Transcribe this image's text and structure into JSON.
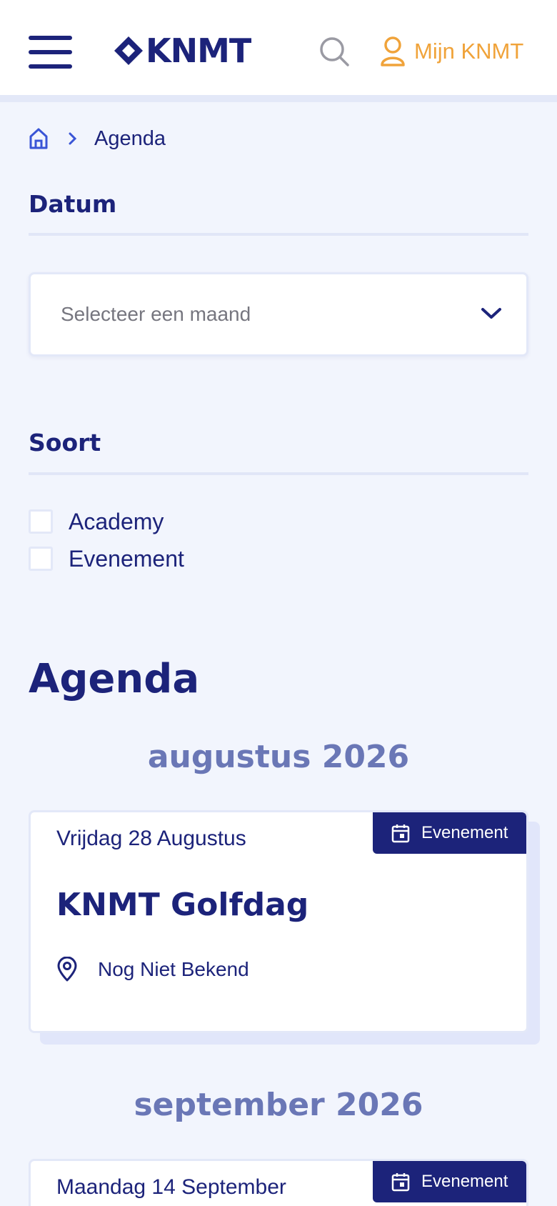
{
  "header": {
    "logo_text": "KNMT",
    "account_label": "Mijn KNMT"
  },
  "breadcrumb": {
    "current": "Agenda"
  },
  "filters": {
    "date_title": "Datum",
    "month_placeholder": "Selecteer een maand",
    "type_title": "Soort",
    "types": [
      {
        "label": "Academy",
        "checked": false
      },
      {
        "label": "Evenement",
        "checked": false
      }
    ]
  },
  "agenda": {
    "title": "Agenda",
    "months": [
      {
        "label": "augustus 2026",
        "events": [
          {
            "date": "Vrijdag 28 Augustus",
            "type": "Evenement",
            "title": "KNMT Golfdag",
            "location": "Nog Niet Bekend"
          }
        ]
      },
      {
        "label": "september 2026",
        "events": [
          {
            "date": "Maandag 14 September",
            "type": "Evenement"
          }
        ]
      }
    ]
  },
  "colors": {
    "brand_navy": "#1c237a",
    "accent_orange": "#f0a33a",
    "month_heading": "#6a77b6",
    "page_background": "#f2f5fd"
  }
}
